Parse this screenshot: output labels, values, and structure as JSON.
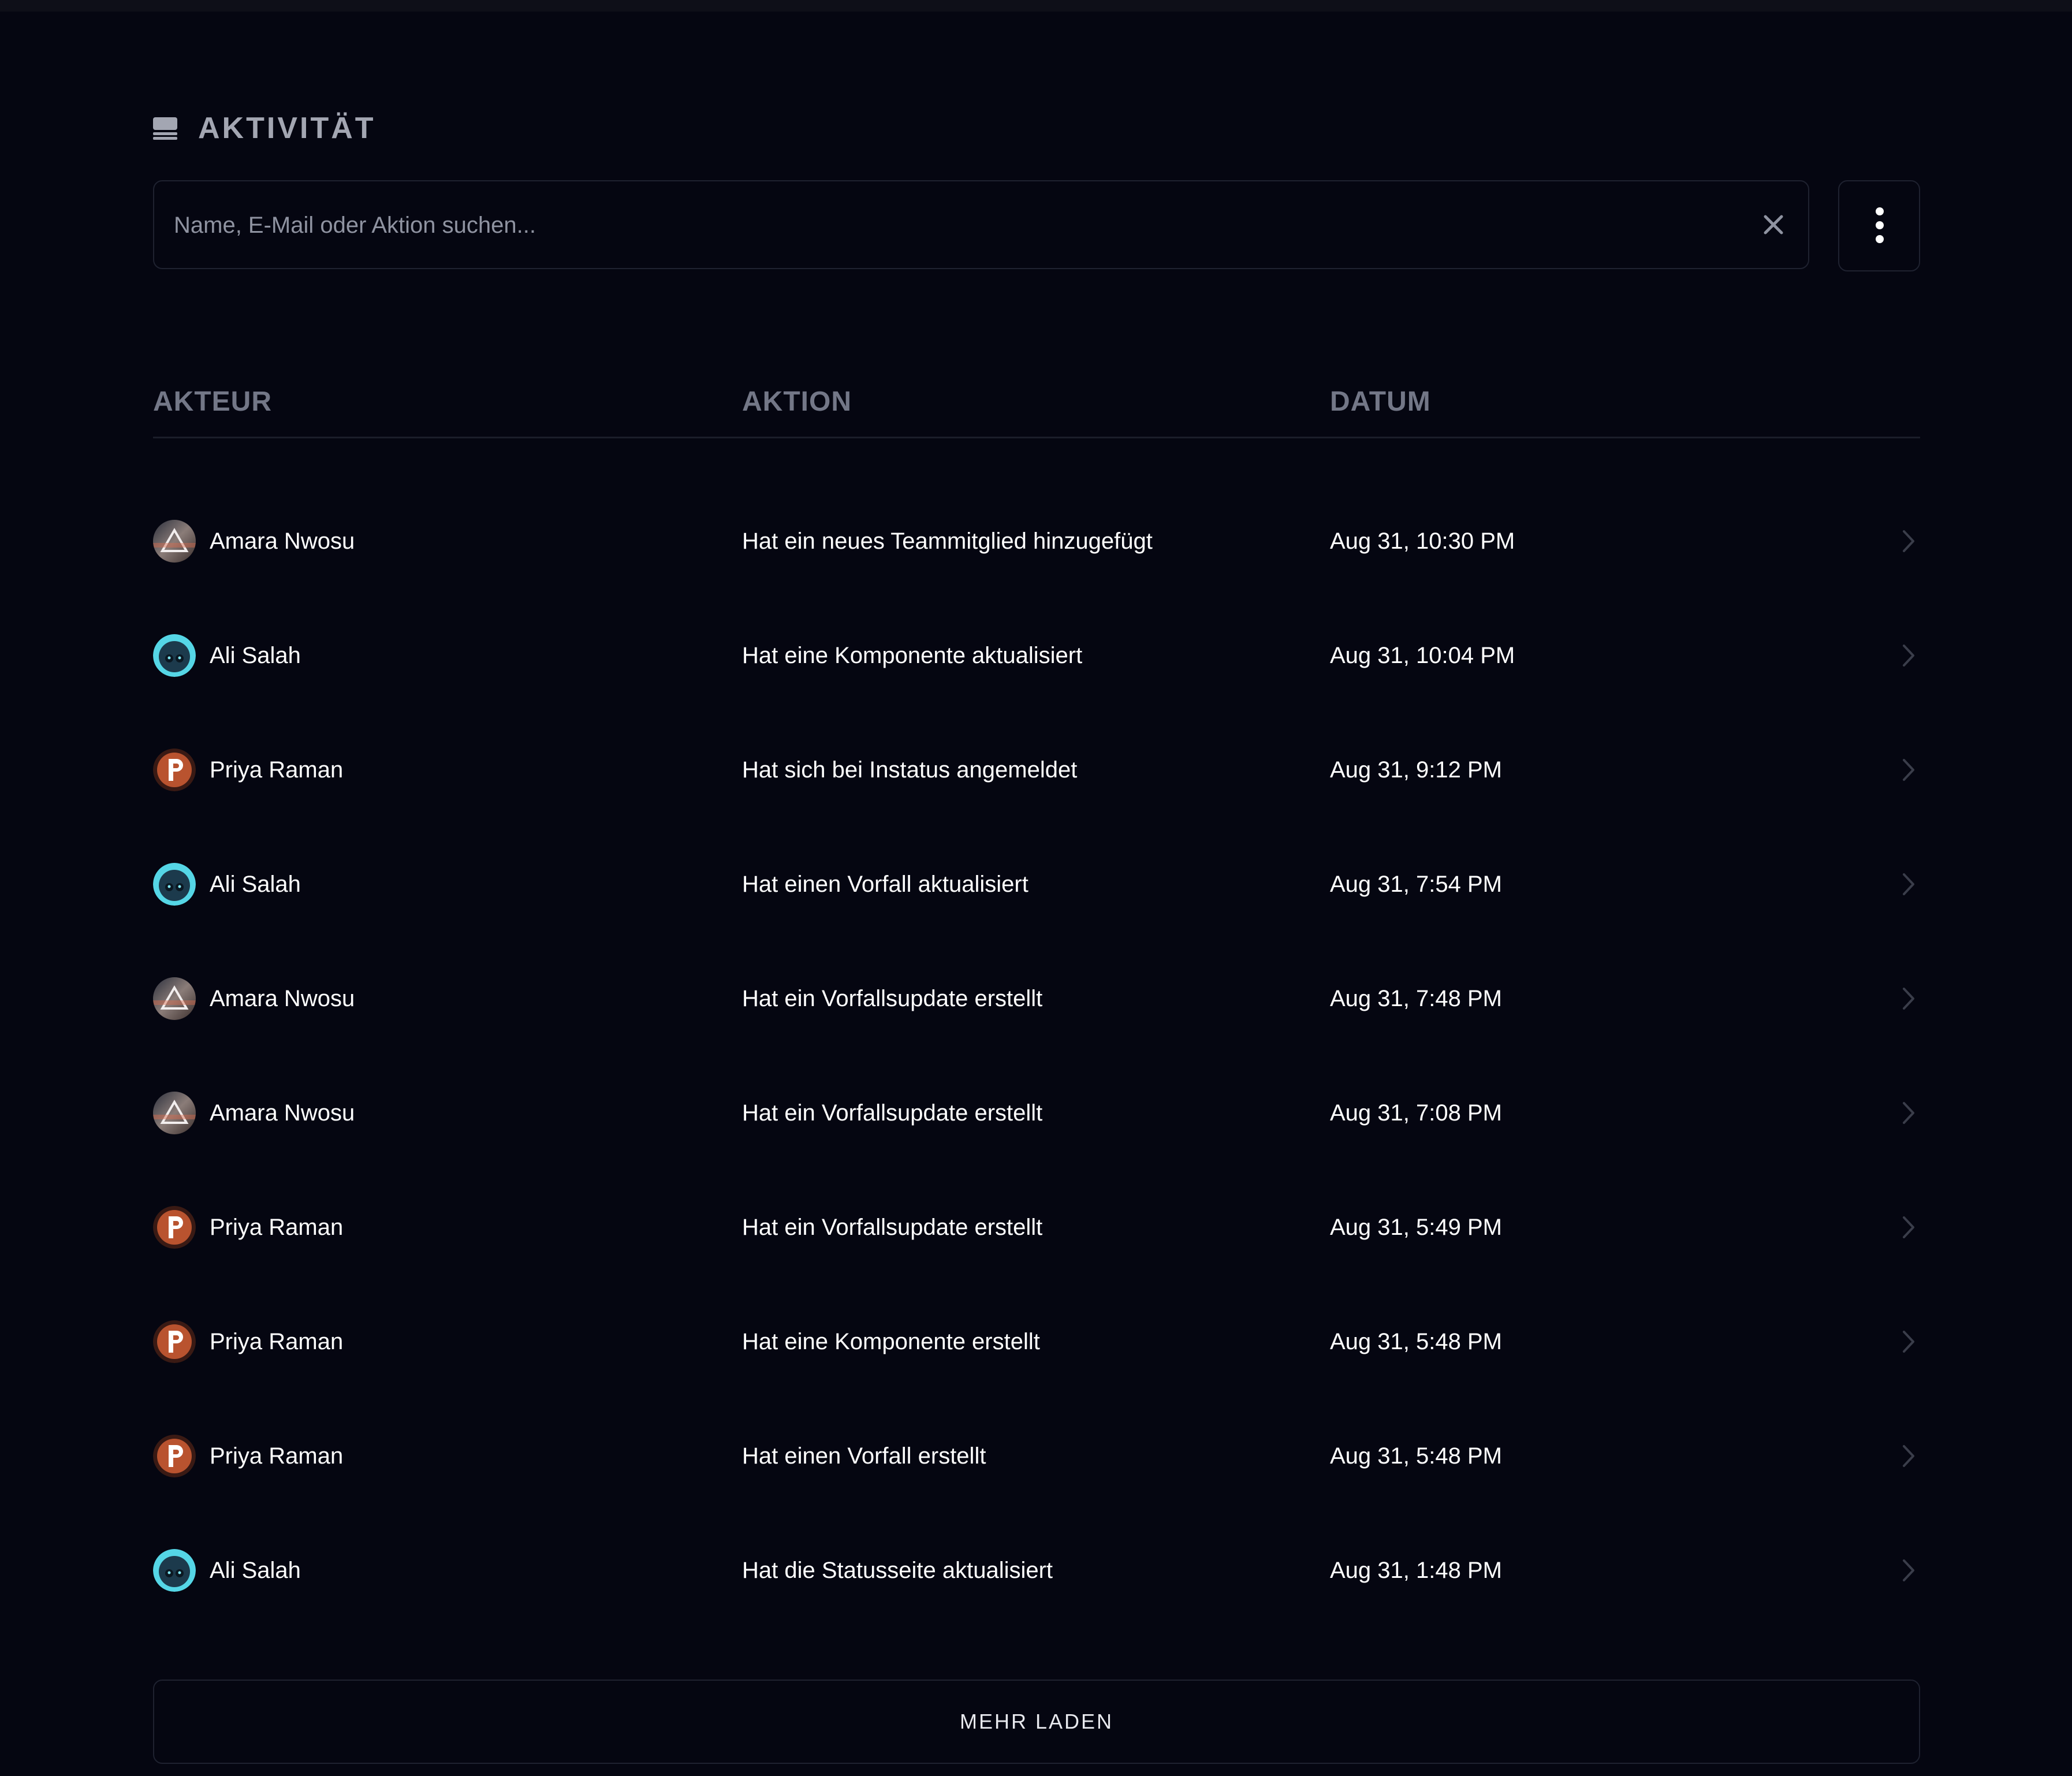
{
  "header": {
    "title": "AKTIVITÄT",
    "icon": "activity-log-icon"
  },
  "search": {
    "placeholder": "Name, E-Mail oder Aktion suchen...",
    "value": ""
  },
  "table": {
    "columns": [
      "AKTEUR",
      "AKTION",
      "DATUM"
    ],
    "rows": [
      {
        "actor": "Amara Nwosu",
        "avatar": "amara",
        "action": "Hat ein neues Teammitglied hinzugefügt",
        "date": "Aug 31, 10:30 PM"
      },
      {
        "actor": "Ali Salah",
        "avatar": "ali",
        "action": "Hat eine Komponente aktualisiert",
        "date": "Aug 31, 10:04 PM"
      },
      {
        "actor": "Priya Raman",
        "avatar": "priya",
        "action": "Hat sich bei Instatus angemeldet",
        "date": "Aug 31, 9:12 PM"
      },
      {
        "actor": "Ali Salah",
        "avatar": "ali",
        "action": "Hat einen Vorfall aktualisiert",
        "date": "Aug 31, 7:54 PM"
      },
      {
        "actor": "Amara Nwosu",
        "avatar": "amara",
        "action": "Hat ein Vorfallsupdate erstellt",
        "date": "Aug 31, 7:48 PM"
      },
      {
        "actor": "Amara Nwosu",
        "avatar": "amara",
        "action": "Hat ein Vorfallsupdate erstellt",
        "date": "Aug 31, 7:08 PM"
      },
      {
        "actor": "Priya Raman",
        "avatar": "priya",
        "action": "Hat ein Vorfallsupdate erstellt",
        "date": "Aug 31, 5:49 PM"
      },
      {
        "actor": "Priya Raman",
        "avatar": "priya",
        "action": "Hat eine Komponente erstellt",
        "date": "Aug 31, 5:48 PM"
      },
      {
        "actor": "Priya Raman",
        "avatar": "priya",
        "action": "Hat einen Vorfall erstellt",
        "date": "Aug 31, 5:48 PM"
      },
      {
        "actor": "Ali Salah",
        "avatar": "ali",
        "action": "Hat die Statusseite aktualisiert",
        "date": "Aug 31, 1:48 PM"
      }
    ]
  },
  "load_more": {
    "label": "MEHR LADEN"
  },
  "colors": {
    "background": "#050611",
    "border": "#1f2230",
    "header_text": "#a3a6b2",
    "column_header_text": "#737787",
    "placeholder_text": "#8f93a1"
  }
}
